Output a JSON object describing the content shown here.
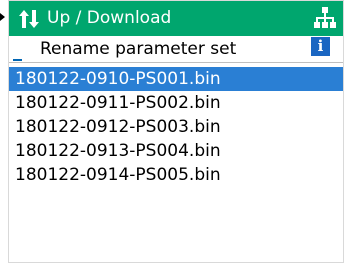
{
  "header": {
    "title": "Up / Download",
    "transfer_icon": "up-down-arrows-icon",
    "network_icon": "network-tree-icon",
    "color": "#00a66e"
  },
  "subheader": {
    "label": "Rename parameter set",
    "info_icon": "info-icon",
    "info_glyph": "i"
  },
  "files": [
    {
      "name": "180122-0910-PS001.bin",
      "selected": true
    },
    {
      "name": "180122-0911-PS002.bin",
      "selected": false
    },
    {
      "name": "180122-0912-PS003.bin",
      "selected": false
    },
    {
      "name": "180122-0913-PS004.bin",
      "selected": false
    },
    {
      "name": "180122-0914-PS005.bin",
      "selected": false
    }
  ],
  "colors": {
    "selection": "#2a7fd4",
    "accent": "#0065b3"
  }
}
